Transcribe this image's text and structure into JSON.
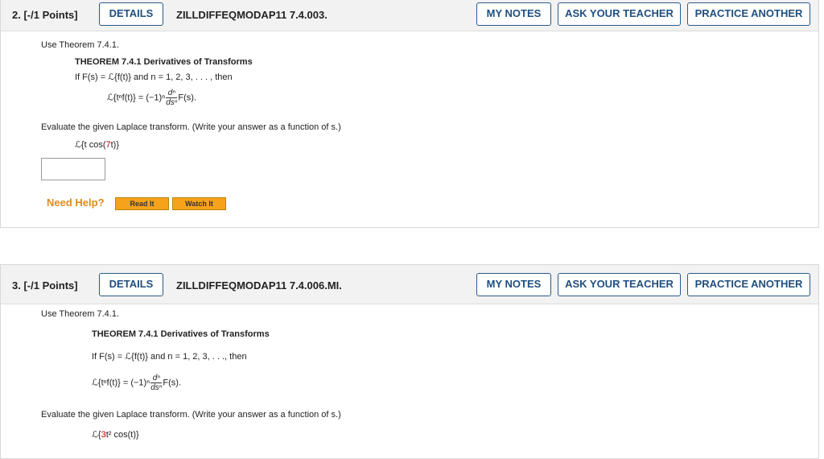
{
  "questions": [
    {
      "points": "2. [-/1 Points]",
      "details": "DETAILS",
      "code": "ZILLDIFFEQMODAP11 7.4.003.",
      "my_notes": "MY NOTES",
      "ask_teacher": "ASK YOUR TEACHER",
      "practice": "PRACTICE ANOTHER",
      "intro": "Use Theorem 7.4.1.",
      "theorem_title": "THEOREM 7.4.1  Derivatives of Transforms",
      "theorem_cond": "If F(s) = ℒ{f(t)} and n = 1, 2, 3, . . . , then",
      "theorem_formula": "ℒ{tⁿf(t)} = (−1)ⁿ",
      "frac_num": "dⁿ",
      "frac_den": "dsⁿ",
      "formula_tail": "F(s).",
      "instruction": "Evaluate the given Laplace transform. (Write your answer as a function of s.)",
      "expr_pre": "ℒ{t cos(",
      "expr_red": "7",
      "expr_post": "t)}",
      "need_help": "Need Help?",
      "read_it": "Read It",
      "watch_it": "Watch It"
    },
    {
      "points": "3. [-/1 Points]",
      "details": "DETAILS",
      "code": "ZILLDIFFEQMODAP11 7.4.006.MI.",
      "my_notes": "MY NOTES",
      "ask_teacher": "ASK YOUR TEACHER",
      "practice": "PRACTICE ANOTHER",
      "intro": "Use Theorem 7.4.1.",
      "theorem_title": "THEOREM 7.4.1  Derivatives of Transforms",
      "theorem_cond": "If F(s) = ℒ{f(t)} and n = 1, 2, 3, . . ., then",
      "theorem_formula": "ℒ{tⁿf(t)} = (−1)ⁿ",
      "frac_num": "dⁿ",
      "frac_den": "dsⁿ",
      "formula_tail": "F(s).",
      "instruction": "Evaluate the given Laplace transform. (Write your answer as a function of s.)",
      "expr_pre": "ℒ{",
      "expr_red": "3",
      "expr_post": "t² cos(t)}"
    }
  ]
}
